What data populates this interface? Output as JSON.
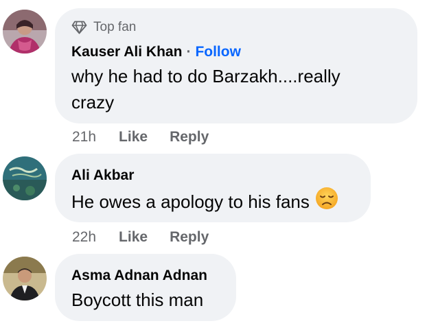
{
  "comments": [
    {
      "badge": "Top fan",
      "author": "Kauser Ali Khan",
      "separator": "·",
      "follow_label": "Follow",
      "text_line1": "why he had to do Barzakh....really",
      "text_line2": "crazy",
      "time": "21h",
      "like_label": "Like",
      "reply_label": "Reply"
    },
    {
      "author": "Ali Akbar",
      "text": "He owes a apology to his fans",
      "emoji": "disappointed-face-icon",
      "time": "22h",
      "like_label": "Like",
      "reply_label": "Reply"
    },
    {
      "author": "Asma Adnan Adnan",
      "text": "Boycott this man"
    }
  ],
  "colors": {
    "bubble_bg": "#f0f2f5",
    "secondary_text": "#65676b",
    "primary_text": "#050505",
    "link_blue": "#0866ff"
  }
}
